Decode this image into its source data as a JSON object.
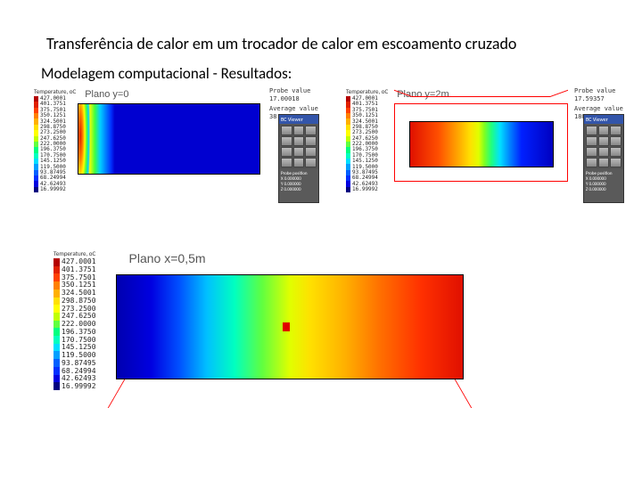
{
  "title": "Transferência de calor em um trocador de calor em escoamento cruzado",
  "subtitle": "Modelagem computacional - Resultados:",
  "legend": {
    "heading": "Temperature, oC",
    "values": [
      "427.0001",
      "401.3751",
      "375.7501",
      "350.1251",
      "324.5001",
      "298.8750",
      "273.2500",
      "247.6250",
      "222.0000",
      "196.3750",
      "170.7500",
      "145.1250",
      "119.5000",
      "93.87495",
      "68.24994",
      "42.62493",
      "16.99992"
    ],
    "colors": [
      "#b40000",
      "#e02000",
      "#ff4000",
      "#ff8000",
      "#ffb000",
      "#ffe000",
      "#ffff00",
      "#c0ff00",
      "#60ff40",
      "#00ff80",
      "#00ffc0",
      "#00e0ff",
      "#00a0ff",
      "#0060ff",
      "#0030ff",
      "#0000e0",
      "#000080"
    ]
  },
  "panel1": {
    "label": "Plano y=0",
    "probe_label": "Probe value",
    "probe_value": "17.00018",
    "avg_label": "Average value",
    "avg_value": "38.85577",
    "viewer": "BC Viewer",
    "probe_pos": "Probe position",
    "coords": [
      "X   0.000000",
      "Y   0.000000",
      "Z   0.000000"
    ]
  },
  "panel2": {
    "label": "Plano y=2m",
    "probe_label": "Probe value",
    "probe_value": "17.59357",
    "avg_label": "Average value",
    "avg_value": "180.5536",
    "viewer": "BC Viewer",
    "probe_pos": "Probe position",
    "coords": [
      "X   0.000000",
      "Y   0.000000",
      "Z   0.000000"
    ]
  },
  "panel3": {
    "label": "Plano x=0,5m"
  }
}
